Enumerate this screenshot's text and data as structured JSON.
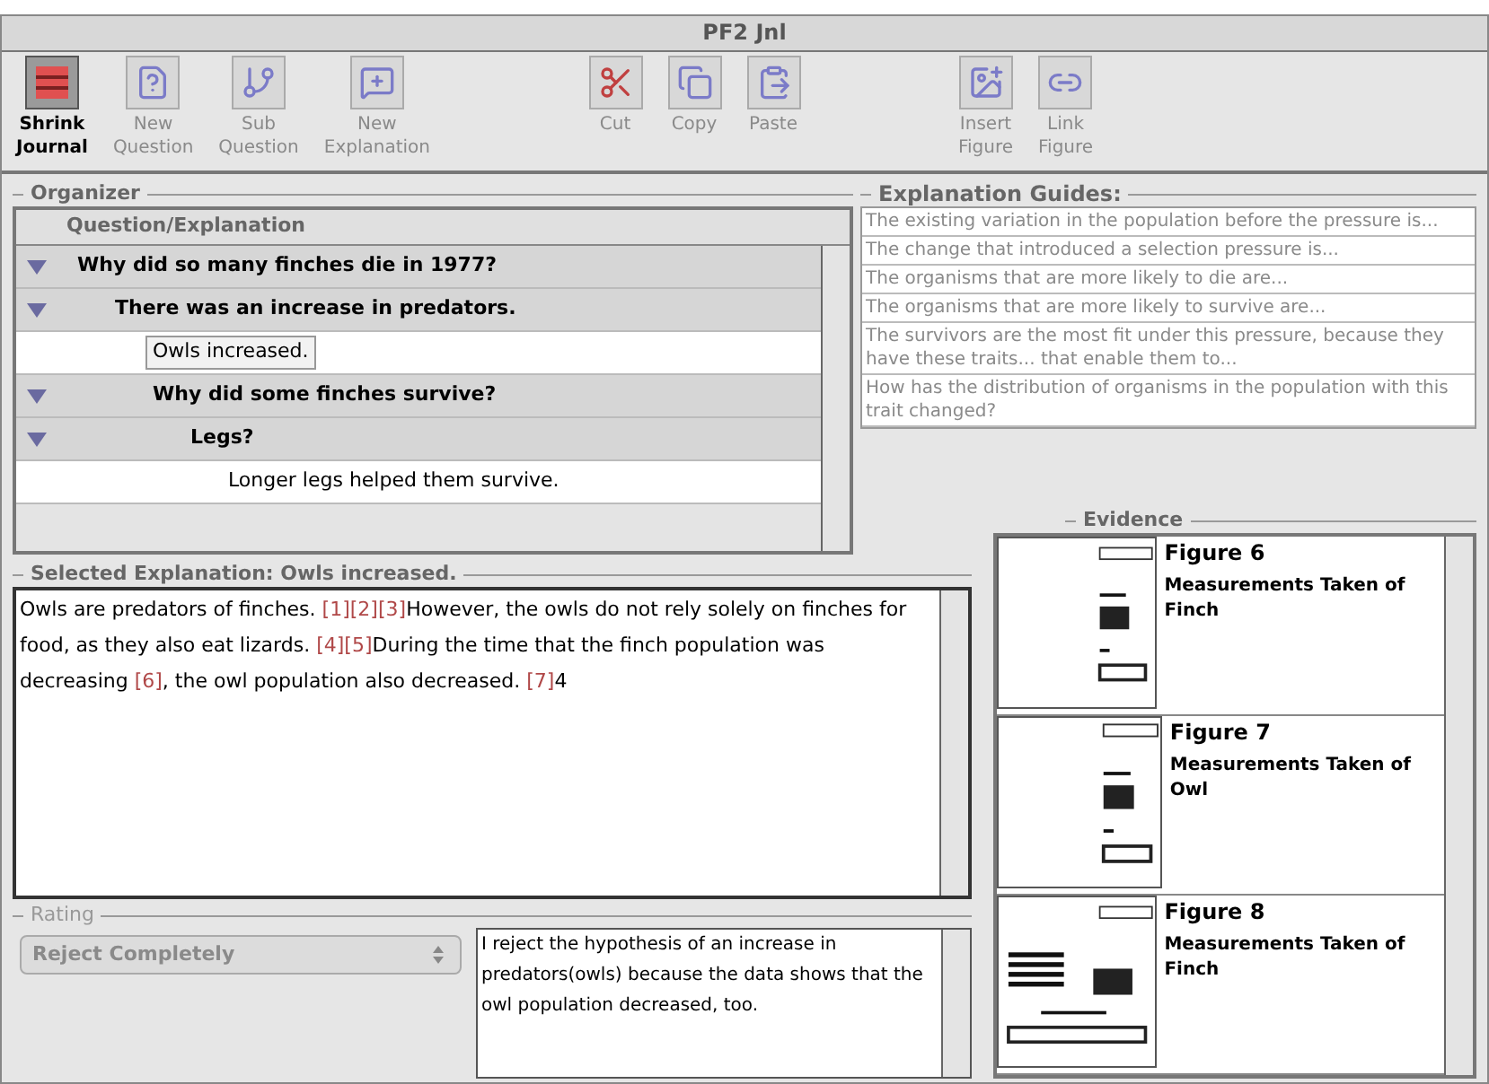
{
  "window": {
    "title": "PF2 Jnl"
  },
  "toolbar": {
    "groups": [
      [
        {
          "label": "Shrink Journal",
          "kind": "shrink",
          "disabled": false
        },
        {
          "label": "New Question",
          "kind": "question",
          "disabled": true
        },
        {
          "label": "Sub Question",
          "kind": "sub",
          "disabled": true
        },
        {
          "label": "New Explanation",
          "kind": "explain",
          "disabled": true
        }
      ],
      [
        {
          "label": "Cut",
          "kind": "cut",
          "disabled": true
        },
        {
          "label": "Copy",
          "kind": "copy",
          "disabled": true
        },
        {
          "label": "Paste",
          "kind": "paste",
          "disabled": true
        }
      ],
      [
        {
          "label": "Insert Figure",
          "kind": "insert",
          "disabled": true
        },
        {
          "label": "Link Figure",
          "kind": "link",
          "disabled": true
        }
      ]
    ]
  },
  "organizer": {
    "title": "Organizer",
    "column": "Question/Explanation",
    "tree": [
      {
        "text": "Why did so many finches die in 1977?",
        "expanded": true,
        "selected": false,
        "children": [
          {
            "text": "There was an increase in predators.",
            "expanded": true,
            "selected": false,
            "children": [
              {
                "text": "Owls increased.",
                "selected": true
              },
              {
                "text": "Why did some finches survive?",
                "expanded": true,
                "selected": false,
                "children": [
                  {
                    "text": "Legs?",
                    "expanded": true,
                    "selected": false,
                    "children": [
                      {
                        "text": "Longer legs helped them survive.",
                        "selected": false
                      }
                    ]
                  }
                ]
              }
            ]
          }
        ]
      }
    ]
  },
  "guides": {
    "title": "Explanation Guides:",
    "items": [
      "The existing variation in the population before the pressure is...",
      "The change that introduced a selection pressure is...",
      "The organisms that are more likely to die are...",
      "The organisms that are more likely to survive are...",
      "The survivors are the most fit under this pressure, because they have these traits... that enable them to...",
      "How has the distribution of organisms in the population with this trait changed?"
    ]
  },
  "selected_explanation": {
    "title": "Selected Explanation: Owls increased.",
    "body": [
      {
        "kind": "text",
        "text": "Owls are predators of finches. "
      },
      {
        "kind": "ref",
        "text": "[1]"
      },
      {
        "kind": "ref",
        "text": "[2]"
      },
      {
        "kind": "ref",
        "text": "[3]"
      },
      {
        "kind": "text",
        "text": "However, the owls do not rely solely on finches for food, as they also eat lizards. "
      },
      {
        "kind": "ref",
        "text": "[4]"
      },
      {
        "kind": "ref",
        "text": "[5]"
      },
      {
        "kind": "text",
        "text": "During the time that the finch population was decreasing "
      },
      {
        "kind": "ref",
        "text": "[6]"
      },
      {
        "kind": "text",
        "text": ", the owl population also decreased. "
      },
      {
        "kind": "ref",
        "text": "[7]"
      },
      {
        "kind": "text",
        "text": "4"
      }
    ]
  },
  "rating": {
    "title": "Rating",
    "value": "Reject Completely",
    "comment": "I reject the hypothesis of an increase in predators(owls) because the data shows that the owl population decreased, too."
  },
  "evidence": {
    "title": "Evidence",
    "items": [
      {
        "title": "Figure 6",
        "caption": "Measurements Taken of Finch",
        "kind": "narrow"
      },
      {
        "title": "Figure 7",
        "caption": "Measurements Taken of Owl",
        "kind": "narrow"
      },
      {
        "title": "Figure 8",
        "caption": "Measurements Taken of Finch",
        "kind": "wide"
      }
    ]
  }
}
